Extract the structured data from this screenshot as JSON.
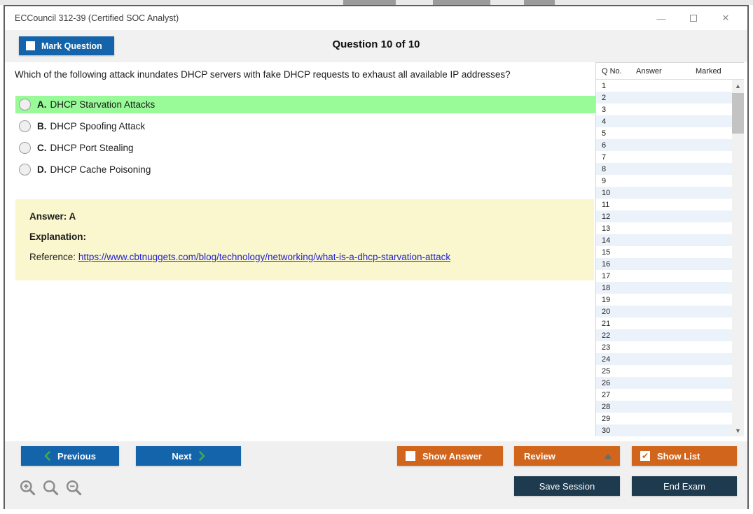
{
  "window": {
    "title": "ECCouncil 312-39 (Certified SOC Analyst)",
    "controls": {
      "minimize": "—",
      "close": "✕"
    }
  },
  "header": {
    "mark_question": "Mark Question",
    "counter": "Question 10 of 10"
  },
  "question": {
    "text": "Which of the following attack inundates DHCP servers with fake DHCP requests to exhaust all available IP addresses?"
  },
  "options": [
    {
      "letter": "A.",
      "text": "DHCP Starvation Attacks",
      "highlighted": true
    },
    {
      "letter": "B.",
      "text": "DHCP Spoofing Attack",
      "highlighted": false
    },
    {
      "letter": "C.",
      "text": "DHCP Port Stealing",
      "highlighted": false
    },
    {
      "letter": "D.",
      "text": "DHCP Cache Poisoning",
      "highlighted": false
    }
  ],
  "explanation": {
    "answer": "Answer: A",
    "label": "Explanation:",
    "reference_label": "Reference:",
    "reference_url": "https://www.cbtnuggets.com/blog/technology/networking/what-is-a-dhcp-starvation-attack"
  },
  "question_list": {
    "columns": [
      "Q No.",
      "Answer",
      "Marked"
    ],
    "rows": [
      "1",
      "2",
      "3",
      "4",
      "5",
      "6",
      "7",
      "8",
      "9",
      "10",
      "11",
      "12",
      "13",
      "14",
      "15",
      "16",
      "17",
      "18",
      "19",
      "20",
      "21",
      "22",
      "23",
      "24",
      "25",
      "26",
      "27",
      "28",
      "29",
      "30"
    ]
  },
  "footer": {
    "previous": "Previous",
    "next": "Next",
    "show_answer": "Show Answer",
    "review": "Review",
    "show_list": "Show List",
    "save_session": "Save Session",
    "end_exam": "End Exam",
    "show_answer_checked": false,
    "show_list_checked": true
  },
  "icons": {
    "zoom": [
      "zoom-in-icon",
      "zoom-icon",
      "zoom-out-icon"
    ]
  },
  "colors": {
    "primary_blue": "#1464ac",
    "orange": "#d2651c",
    "dark_navy": "#1d3a4f",
    "highlight_green": "#98fb98",
    "explanation_yellow": "#faf6cd",
    "link_blue": "#2323d0",
    "alt_row_blue": "#ecf2f9"
  }
}
